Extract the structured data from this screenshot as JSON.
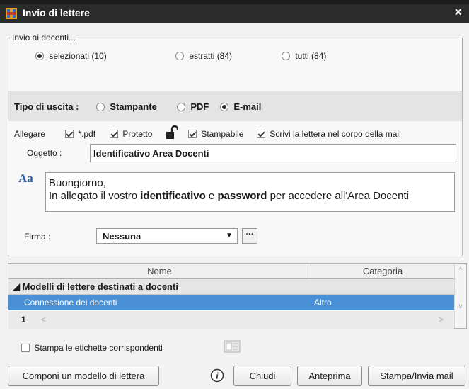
{
  "window": {
    "title": "Invio di lettere",
    "close_icon": "×"
  },
  "recipients": {
    "legend": "Invio ai docenti...",
    "options": [
      {
        "label": "selezionati (10)",
        "checked": true
      },
      {
        "label": "estratti (84)",
        "checked": false
      },
      {
        "label": "tutti (84)",
        "checked": false
      }
    ]
  },
  "output": {
    "label": "Tipo di uscita :",
    "options": [
      {
        "label": "Stampante",
        "checked": false
      },
      {
        "label": "PDF",
        "checked": false
      },
      {
        "label": "E-mail",
        "checked": true
      }
    ],
    "attach_label": "Allegare",
    "attach_options": [
      {
        "label": "*.pdf",
        "checked": true
      },
      {
        "label": "Protetto",
        "checked": true
      },
      {
        "label": "Stampabile",
        "checked": true
      },
      {
        "label": "Scrivi la lettera nel corpo della mail",
        "checked": true
      }
    ],
    "subject_label": "Oggetto :",
    "subject_value": "Identificativo Area Docenti",
    "font_icon": "Aa",
    "body": {
      "line1": "Buongiorno,",
      "line2_a": "In allegato il vostro ",
      "line2_b": "identificativo",
      "line2_c": " e ",
      "line2_d": "password",
      "line2_e": " per accedere all'Area Docenti"
    },
    "signature_label": "Firma :",
    "signature_value": "Nessuna",
    "signature_button": "···"
  },
  "templates": {
    "columns": [
      "Nome",
      "Categoria"
    ],
    "group": "Modelli di lettere destinati a docenti",
    "rows": [
      {
        "name": "Connessione dei docenti",
        "category": "Altro"
      }
    ],
    "page": "1"
  },
  "labels_checkbox": {
    "label": "Stampa le etichette corrispondenti",
    "checked": false
  },
  "buttons": {
    "compose": "Componi un modello di lettera",
    "close": "Chiudi",
    "preview": "Anteprima",
    "print_send": "Stampa/Invia mail"
  }
}
